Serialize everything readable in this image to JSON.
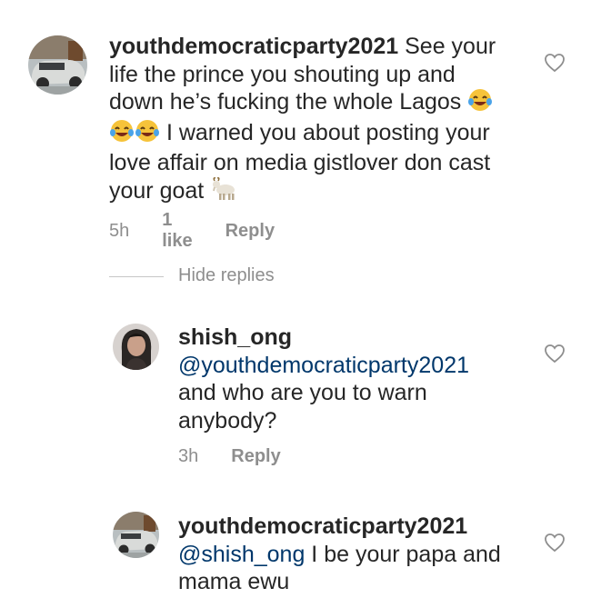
{
  "comments": [
    {
      "username": "youthdemocraticparty2021",
      "body_line1": " See your",
      "body_line2": "life the prince you shouting up and",
      "body_line3": "down he’s fucking the whole Lagos ",
      "body_line4": " I warned you about posting your",
      "body_line5": "love affair on media gistlover don cast",
      "body_line6": "your goat ",
      "time": "5h",
      "likes": "1 like",
      "reply_label": "Reply",
      "avatar_icon": "car-photo-avatar"
    }
  ],
  "hide_replies_label": "Hide replies",
  "replies": [
    {
      "username": "shish_ong",
      "mention": "@youthdemocraticparty2021",
      "body_line1": "and who are you to warn",
      "body_line2": "anybody?",
      "time": "3h",
      "reply_label": "Reply",
      "avatar_icon": "person-photo-avatar"
    },
    {
      "username": "youthdemocraticparty2021",
      "mention": "@shish_ong",
      "body_line1": " I be your papa and",
      "body_line2": "mama ewu",
      "avatar_icon": "car-photo-avatar"
    }
  ],
  "colors": {
    "mention": "#00376b",
    "meta": "#8e8e8e",
    "text": "#262626"
  },
  "icons": [
    "laughing-emoji-icon",
    "goat-emoji-icon",
    "heart-outline-icon"
  ]
}
